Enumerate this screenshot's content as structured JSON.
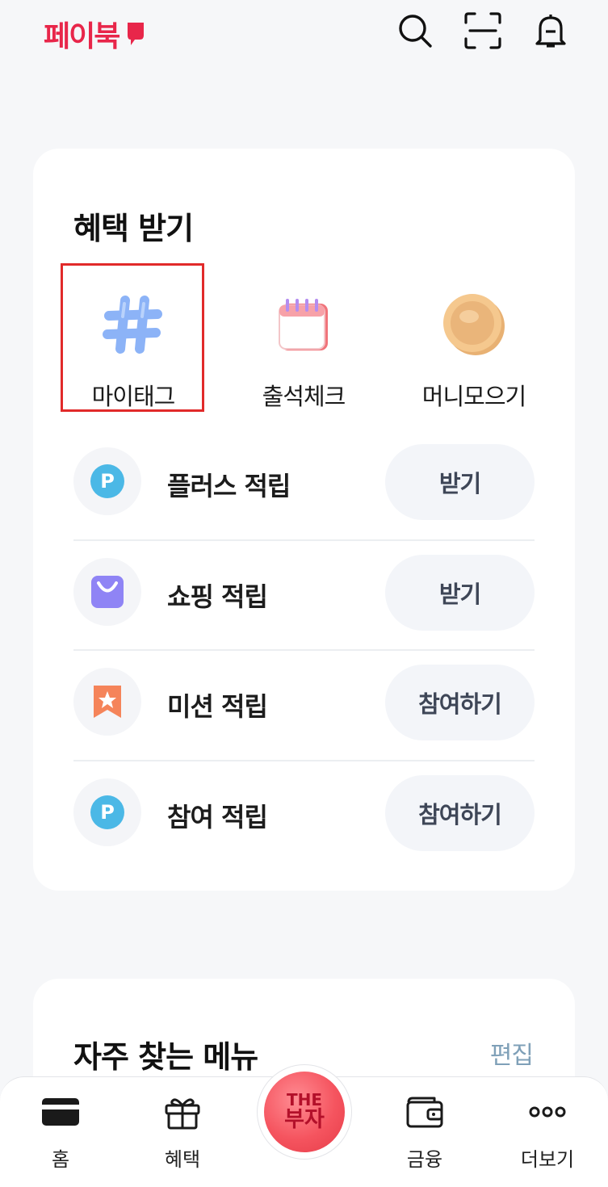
{
  "header": {
    "logo_text": "페이북",
    "icons": [
      "search-icon",
      "scan-icon",
      "bell-icon"
    ]
  },
  "benefits": {
    "title": "혜택 받기",
    "quick": [
      {
        "label": "마이태그",
        "icon": "hashtag-icon",
        "highlighted": true
      },
      {
        "label": "출석체크",
        "icon": "calendar-icon"
      },
      {
        "label": "머니모으기",
        "icon": "coin-icon"
      }
    ],
    "rows": [
      {
        "title": "플러스 적립",
        "button": "받기",
        "icon": "point-icon"
      },
      {
        "title": "쇼핑 적립",
        "button": "받기",
        "icon": "shopping-bag-icon"
      },
      {
        "title": "미션 적립",
        "button": "참여하기",
        "icon": "star-bookmark-icon"
      },
      {
        "title": "참여 적립",
        "button": "참여하기",
        "icon": "point-icon"
      }
    ]
  },
  "frequent": {
    "title": "자주 찾는 메뉴",
    "edit_label": "편집"
  },
  "tabbar": {
    "tabs": [
      {
        "label": "홈",
        "icon": "card-icon"
      },
      {
        "label": "혜택",
        "icon": "gift-icon"
      },
      {
        "label": "금융",
        "icon": "wallet-icon"
      },
      {
        "label": "더보기",
        "icon": "more-icon"
      }
    ],
    "center_line1": "THE",
    "center_line2": "부자"
  },
  "colors": {
    "brand": "#e8264a",
    "highlight_border": "#e12a2a",
    "point_blue": "#4bb8e6",
    "shopping_purple": "#8f84f5",
    "mission_orange": "#f5845a",
    "edit_link": "#7fa0b8"
  }
}
